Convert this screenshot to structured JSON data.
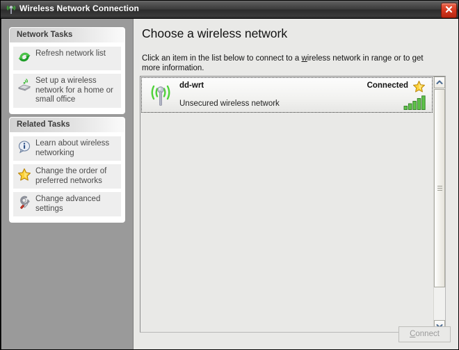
{
  "window": {
    "title": "Wireless Network Connection",
    "icon": "wireless-tower-icon",
    "close_label": "x"
  },
  "sidebar": {
    "panels": [
      {
        "title": "Network Tasks",
        "tasks": [
          {
            "label": "Refresh network list",
            "icon": "refresh-icon"
          },
          {
            "label": "Set up a wireless network for a home or small office",
            "icon": "wireless-setup-icon"
          }
        ]
      },
      {
        "title": "Related Tasks",
        "tasks": [
          {
            "label": "Learn about wireless networking",
            "icon": "info-icon"
          },
          {
            "label": "Change the order of preferred networks",
            "icon": "star-icon"
          },
          {
            "label": "Change advanced settings",
            "icon": "wrench-icon"
          }
        ]
      }
    ]
  },
  "main": {
    "heading": "Choose a wireless network",
    "description_part1": "Click an item in the list below to connect to a ",
    "description_accel": "w",
    "description_part2": "ireless network in range or to get more information.",
    "networks": [
      {
        "ssid": "dd-wrt",
        "status": "Connected",
        "security": "Unsecured wireless network",
        "signal_bars": 5,
        "preferred": true,
        "selected": true
      }
    ]
  },
  "footer": {
    "connect_accel": "C",
    "connect_rest": "onnect",
    "connect_enabled": false
  },
  "colors": {
    "titlebar_dark": "#3c3c3c",
    "close_red": "#d83b22",
    "sidebar_grey": "#9a9a9a",
    "content_bg": "#e9e9e7",
    "signal_green": "#5fc24a",
    "star_gold": "#f5c518"
  }
}
